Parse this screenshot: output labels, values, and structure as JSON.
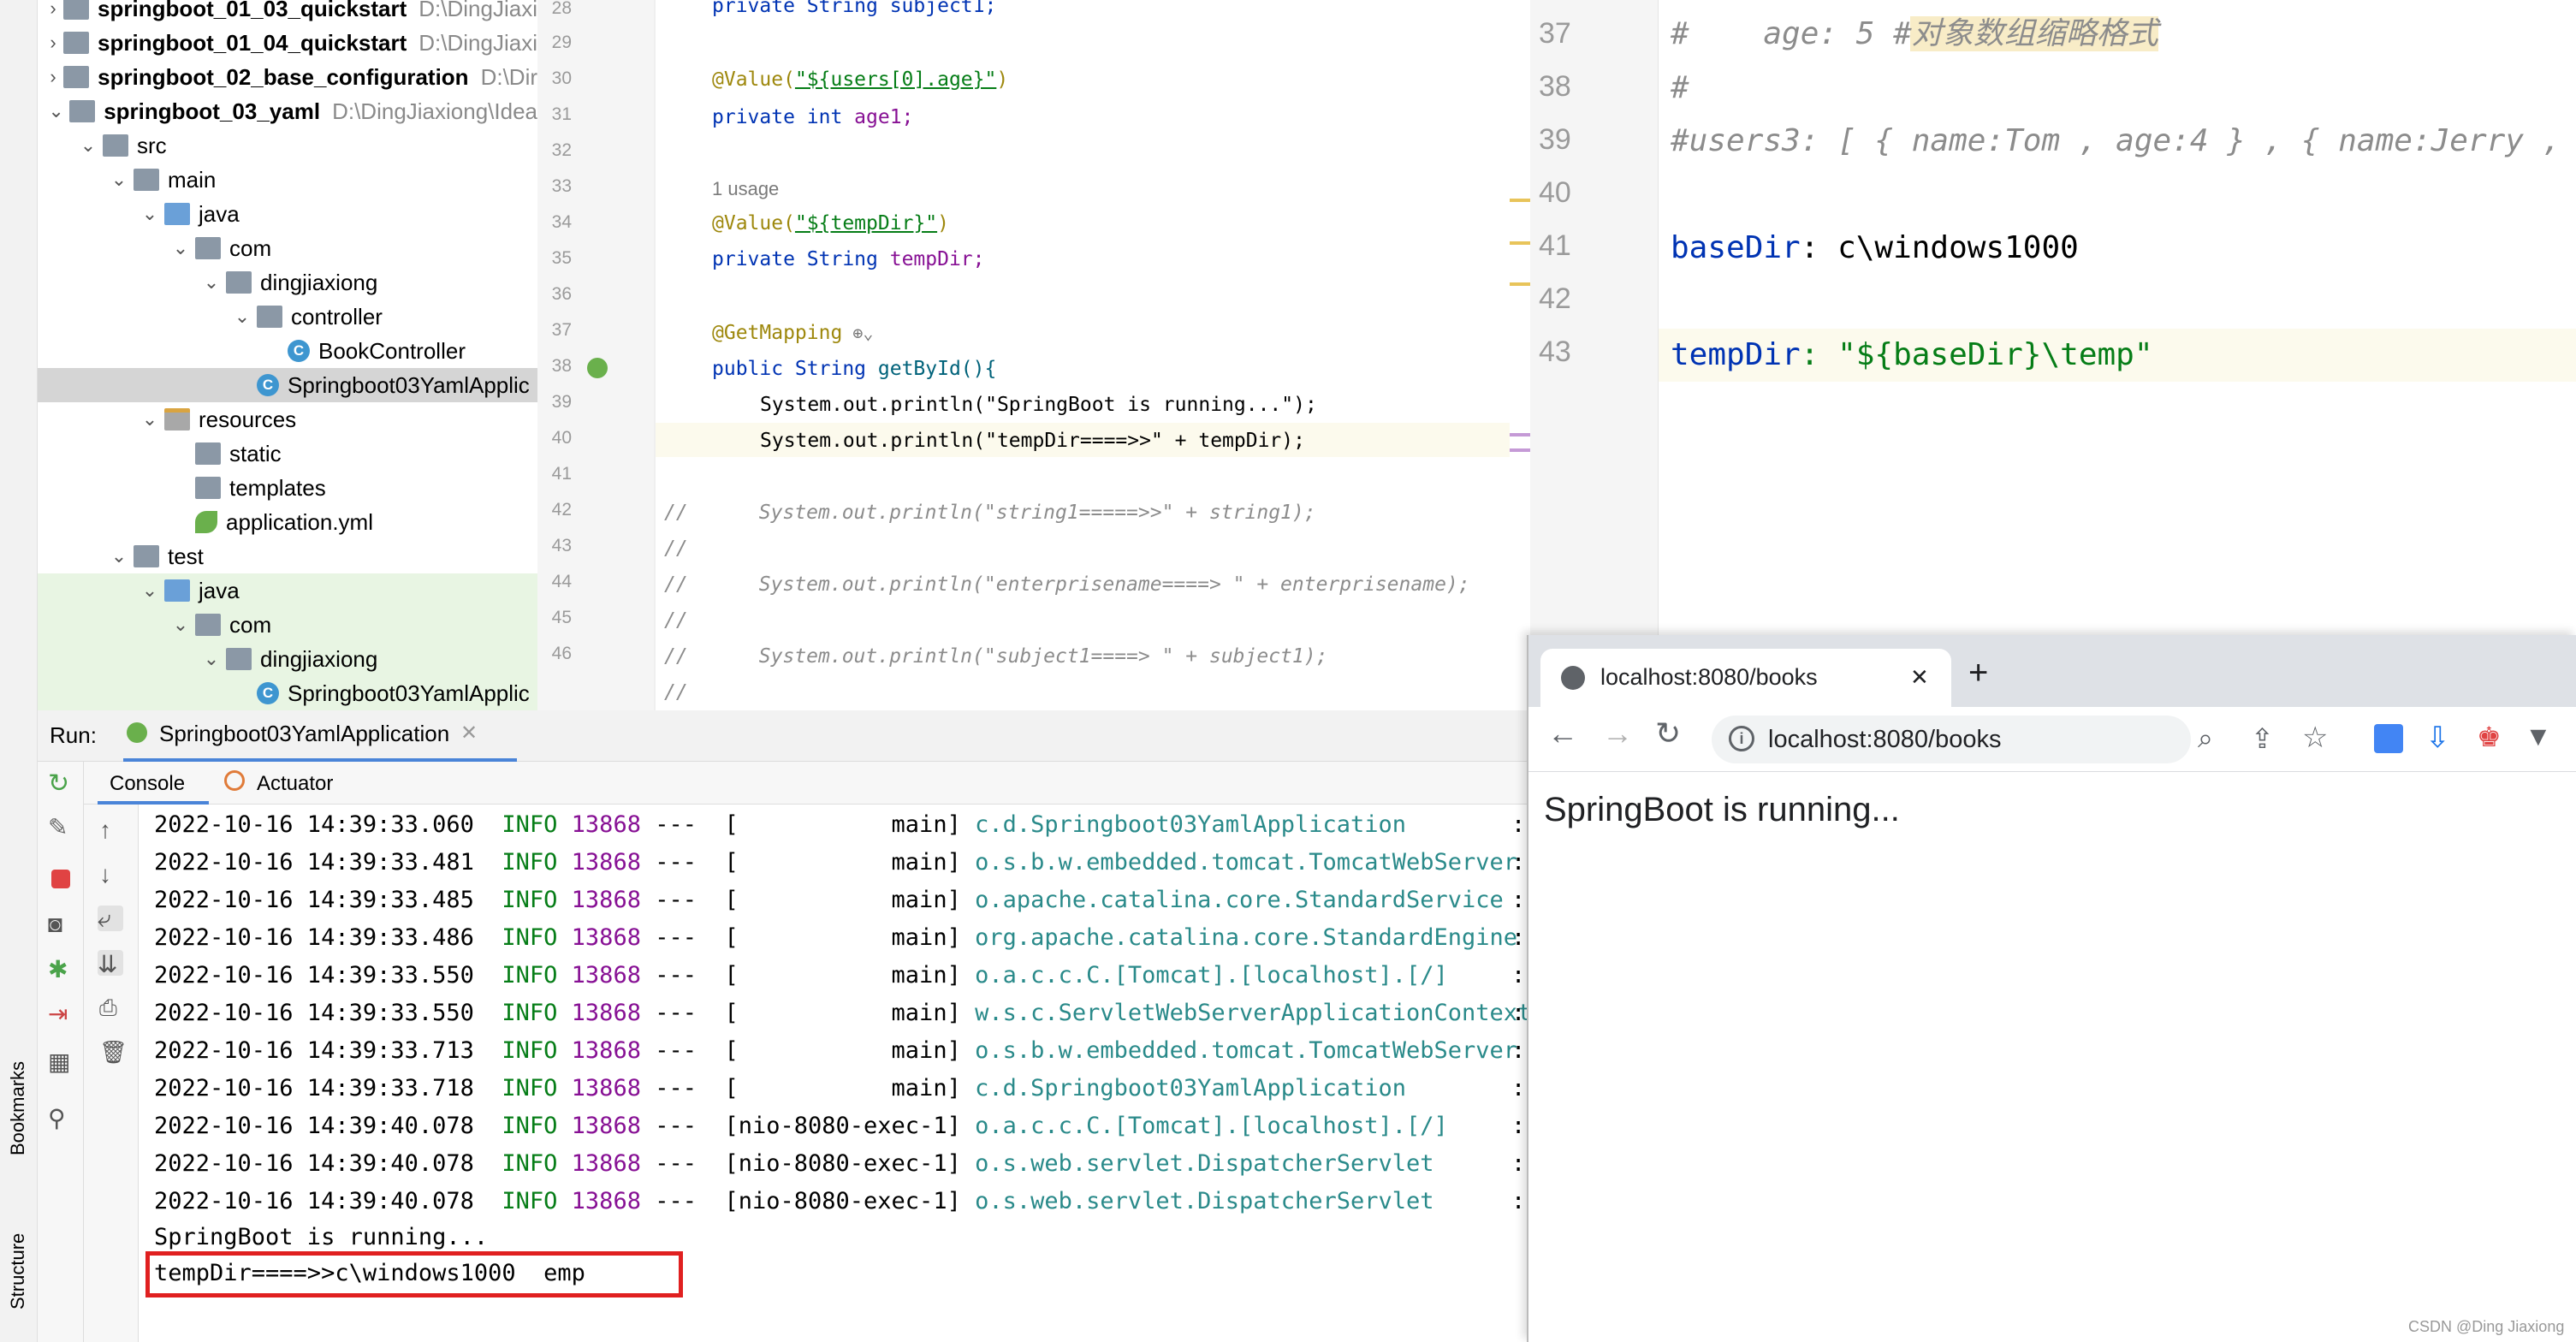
{
  "tree": {
    "items": [
      {
        "name": "springboot_01_03_quickstart",
        "path": "D:\\DingJiaxi"
      },
      {
        "name": "springboot_01_04_quickstart",
        "path": "D:\\DingJiaxi"
      },
      {
        "name": "springboot_02_base_configuration",
        "path": "D:\\Dir"
      },
      {
        "name": "springboot_03_yaml",
        "path": "D:\\DingJiaxiong\\Idea"
      },
      {
        "name": "src"
      },
      {
        "name": "main"
      },
      {
        "name": "java"
      },
      {
        "name": "com"
      },
      {
        "name": "dingjiaxiong"
      },
      {
        "name": "controller"
      },
      {
        "name": "BookController"
      },
      {
        "name": "Springboot03YamlApplic"
      },
      {
        "name": "resources"
      },
      {
        "name": "static"
      },
      {
        "name": "templates"
      },
      {
        "name": "application.yml"
      },
      {
        "name": "test"
      },
      {
        "name": "java"
      },
      {
        "name": "com"
      },
      {
        "name": "dingjiaxiong"
      },
      {
        "name": "Springboot03YamlApplic"
      }
    ]
  },
  "editor": {
    "lines": [
      "28",
      "29",
      "30",
      "31",
      "32",
      "33",
      "34",
      "35",
      "36",
      "37",
      "38",
      "39",
      "40",
      "41",
      "42",
      "43",
      "44",
      "45",
      "46"
    ],
    "usage": "1 usage",
    "code": {
      "l28": "private String subject1;",
      "l30a": "@Value(",
      "l30b": "\"${users[0].age}\"",
      "l30c": ")",
      "l31a": "private int ",
      "l31b": "age1;",
      "l33a": "@Value(",
      "l33b": "\"${tempDir}\"",
      "l33c": ")",
      "l34a": "private String ",
      "l34b": "tempDir;",
      "l36": "@GetMapping",
      "l37a": "public String ",
      "l37b": "getById(){",
      "l38": "System.out.println(\"SpringBoot is running...\");",
      "l39": "System.out.println(\"tempDir====>>\" + tempDir);",
      "l41": "//      System.out.println(\"string1=====>>\" + string1);",
      "l42": "//",
      "l43": "//      System.out.println(\"enterprisename====> \" + enterprisename);",
      "l44": "//",
      "l45": "//      System.out.println(\"subject1====> \" + subject1);",
      "l46": "//"
    }
  },
  "yml": {
    "lines": [
      "37",
      "38",
      "39",
      "40",
      "41",
      "42",
      "43"
    ],
    "l37": "#    age: 5 #对象数组缩略格式",
    "l38": "#",
    "l39": "#users3: [ { name:Tom , age:4 } , { name:Jerry ,",
    "l41k": "baseDir",
    "l41v": ": c\\windows1000",
    "l43k": "tempDir",
    "l43v": ": \"${baseDir}\\temp\""
  },
  "run": {
    "label": "Run:",
    "config": "Springboot03YamlApplication",
    "tabs": [
      "Console",
      "Actuator"
    ],
    "logs": [
      {
        "ts": "2022-10-16 14:39:33.060",
        "lvl": "INFO",
        "pid": "13868",
        "thr": "---  [           main]",
        "cls": "c.d.Springboot03YamlApplication"
      },
      {
        "ts": "2022-10-16 14:39:33.481",
        "lvl": "INFO",
        "pid": "13868",
        "thr": "---  [           main]",
        "cls": "o.s.b.w.embedded.tomcat.TomcatWebServer"
      },
      {
        "ts": "2022-10-16 14:39:33.485",
        "lvl": "INFO",
        "pid": "13868",
        "thr": "---  [           main]",
        "cls": "o.apache.catalina.core.StandardService"
      },
      {
        "ts": "2022-10-16 14:39:33.486",
        "lvl": "INFO",
        "pid": "13868",
        "thr": "---  [           main]",
        "cls": "org.apache.catalina.core.StandardEngine"
      },
      {
        "ts": "2022-10-16 14:39:33.550",
        "lvl": "INFO",
        "pid": "13868",
        "thr": "---  [           main]",
        "cls": "o.a.c.c.C.[Tomcat].[localhost].[/]"
      },
      {
        "ts": "2022-10-16 14:39:33.550",
        "lvl": "INFO",
        "pid": "13868",
        "thr": "---  [           main]",
        "cls": "w.s.c.ServletWebServerApplicationContext"
      },
      {
        "ts": "2022-10-16 14:39:33.713",
        "lvl": "INFO",
        "pid": "13868",
        "thr": "---  [           main]",
        "cls": "o.s.b.w.embedded.tomcat.TomcatWebServer"
      },
      {
        "ts": "2022-10-16 14:39:33.718",
        "lvl": "INFO",
        "pid": "13868",
        "thr": "---  [           main]",
        "cls": "c.d.Springboot03YamlApplication"
      },
      {
        "ts": "2022-10-16 14:39:40.078",
        "lvl": "INFO",
        "pid": "13868",
        "thr": "---  [nio-8080-exec-1]",
        "cls": "o.a.c.c.C.[Tomcat].[localhost].[/]"
      },
      {
        "ts": "2022-10-16 14:39:40.078",
        "lvl": "INFO",
        "pid": "13868",
        "thr": "---  [nio-8080-exec-1]",
        "cls": "o.s.web.servlet.DispatcherServlet"
      },
      {
        "ts": "2022-10-16 14:39:40.078",
        "lvl": "INFO",
        "pid": "13868",
        "thr": "---  [nio-8080-exec-1]",
        "cls": "o.s.web.servlet.DispatcherServlet"
      }
    ],
    "out1": "SpringBoot is running...",
    "out2": "tempDir====>>c\\windows1000  emp"
  },
  "side": {
    "bookmarks": "Bookmarks",
    "structure": "Structure"
  },
  "browser": {
    "tab_title": "localhost:8080/books",
    "close": "✕",
    "newtab": "+",
    "url": "localhost:8080/books",
    "body": "SpringBoot is running...",
    "watermark": "CSDN @Ding Jiaxiong"
  }
}
